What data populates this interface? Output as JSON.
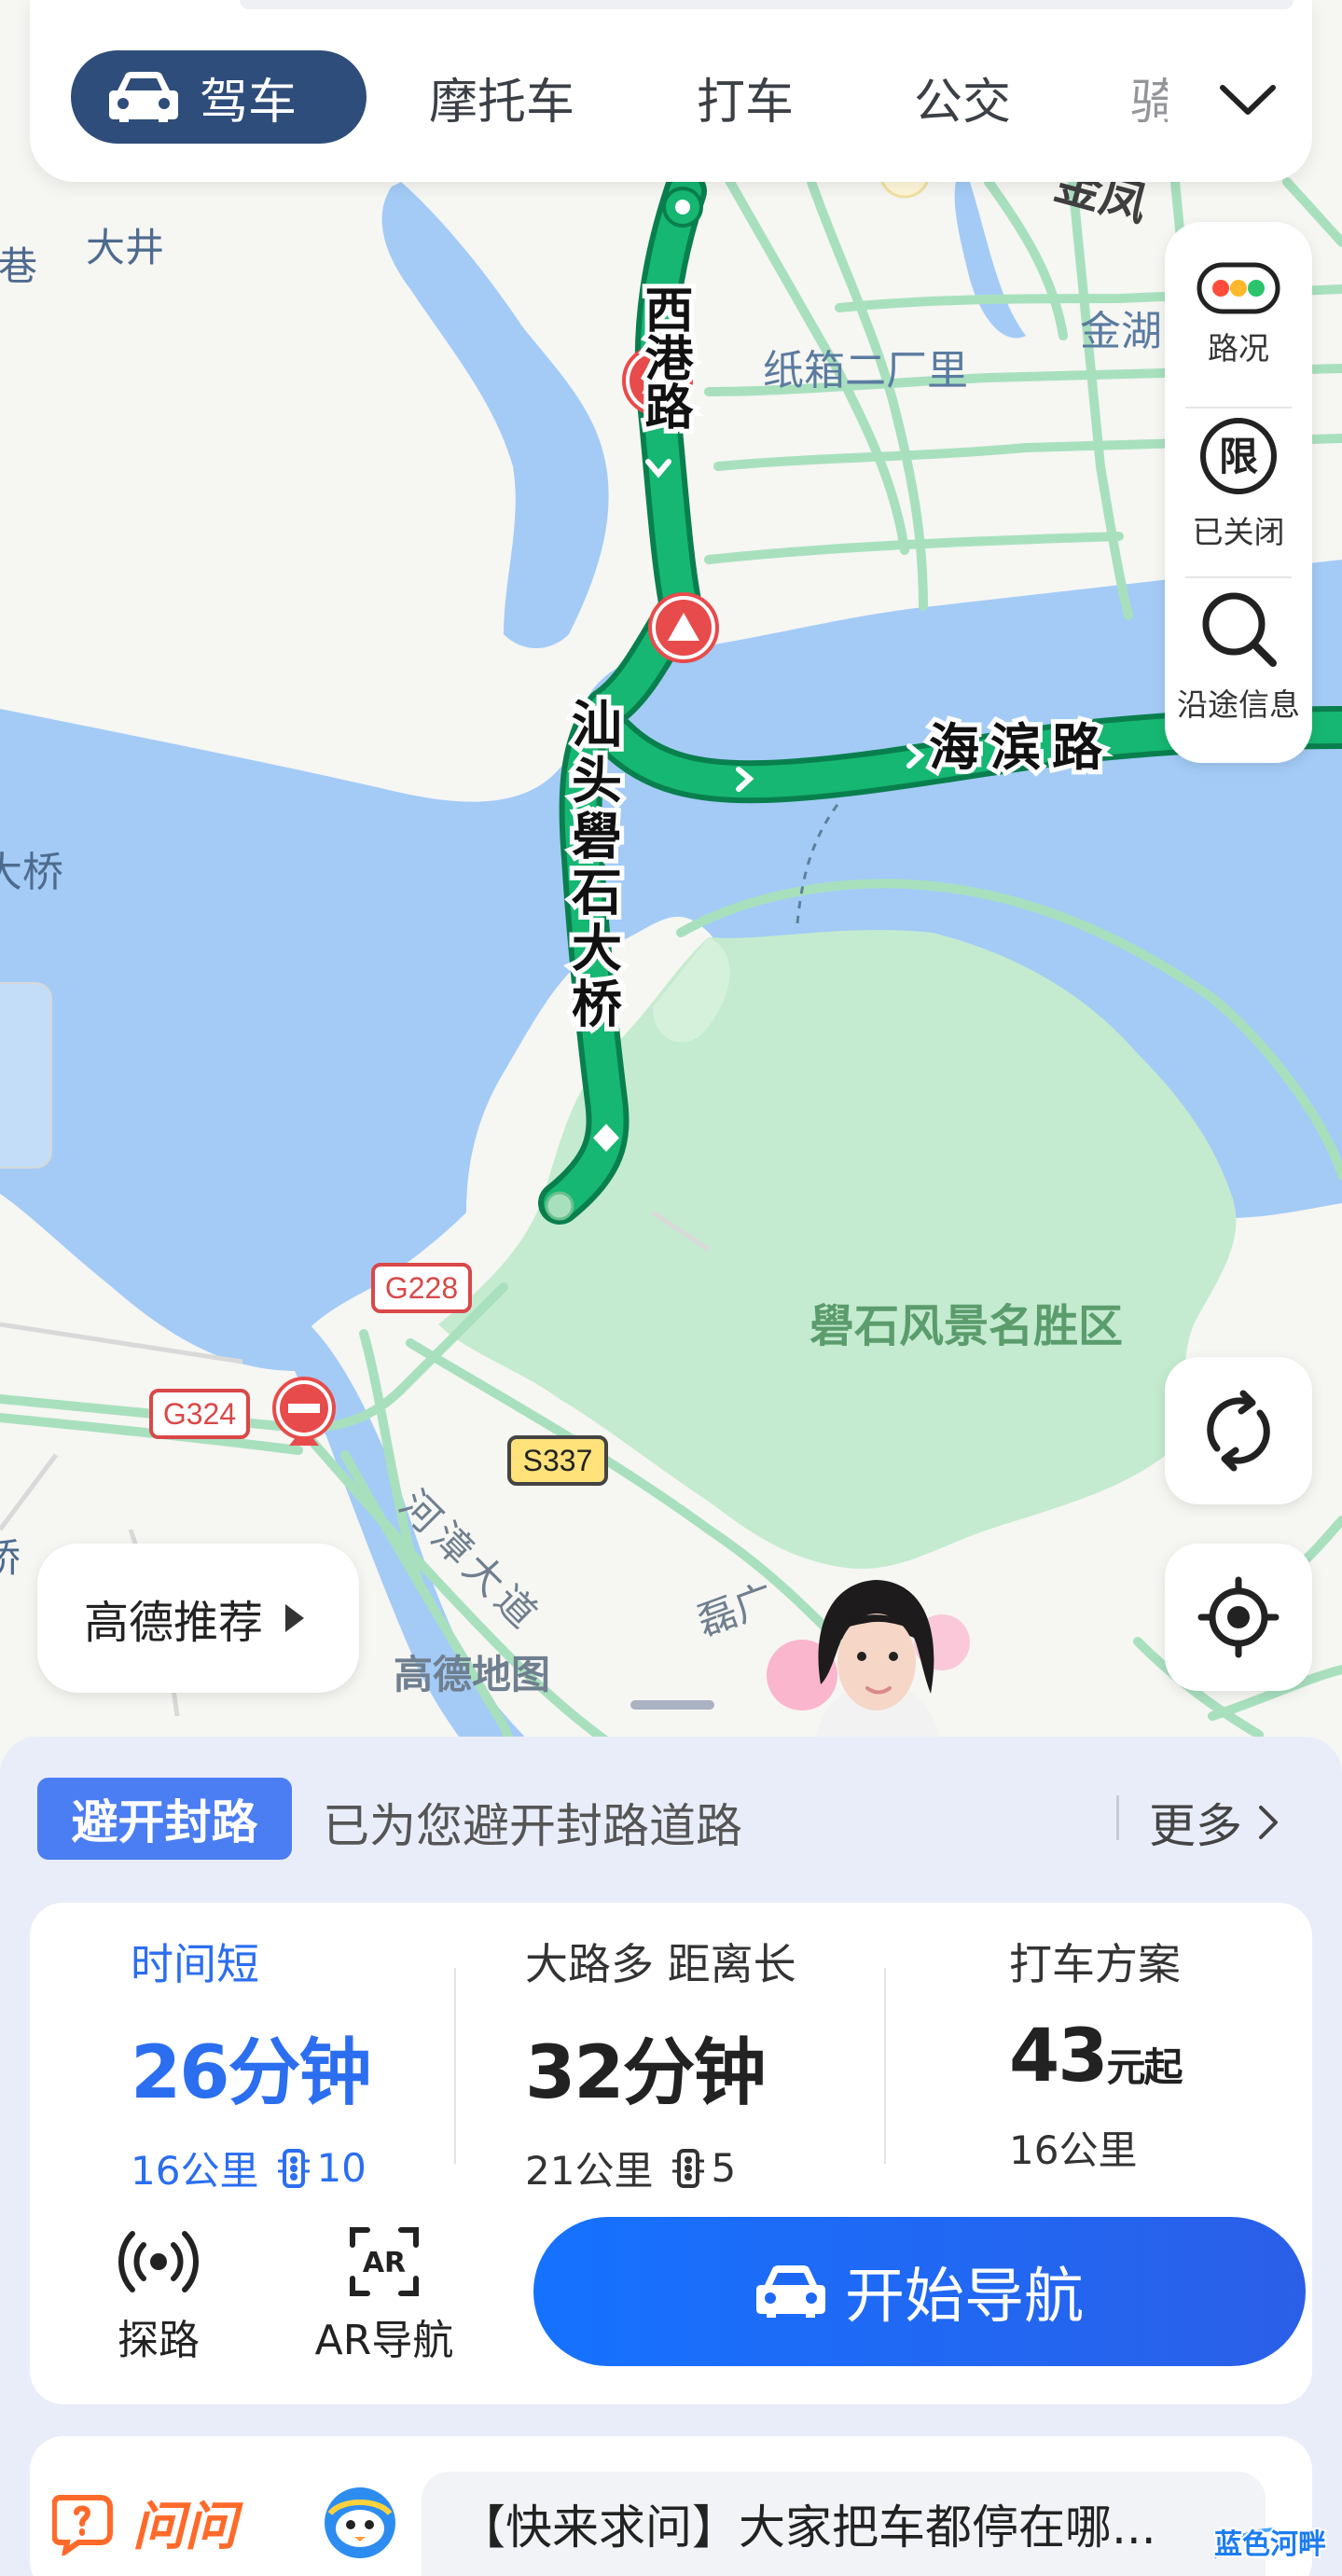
{
  "tabs": [
    {
      "label": "驾车"
    },
    {
      "label": "摩托车"
    },
    {
      "label": "打车"
    },
    {
      "label": "公交"
    },
    {
      "label": "骑"
    }
  ],
  "map": {
    "labels": {
      "dajing": "大井",
      "xigang": "西港路",
      "zhixiang": "纸箱二厂里",
      "jinhu": "金湖",
      "jinfeng": "金凤",
      "shantou_bridge": "汕头礐石大桥",
      "haibin": "海滨路",
      "daqiao_left": "大桥",
      "scenic": "礐石风景名胜区",
      "g228": "G228",
      "g324": "G324",
      "s337": "S337",
      "heyong": "河漳大道",
      "lei": "磊广",
      "gaode_map": "高德地图",
      "qiao_left": "桥",
      "xiang_left": "巷"
    }
  },
  "side_panel": {
    "traffic": "路况",
    "restriction": "已关闭",
    "restriction_icon_text": "限",
    "along_route": "沿途信息"
  },
  "recommend": "高德推荐",
  "avoid": {
    "badge": "避开封路",
    "text": "已为您避开封路道路",
    "more": "更多"
  },
  "routes": [
    {
      "tag": "时间短",
      "time_num": "26分钟",
      "distance": "16公里",
      "lights": "10"
    },
    {
      "tag": "大路多 距离长",
      "time_num": "32分钟",
      "distance": "21公里",
      "lights": "5"
    },
    {
      "tag": "打车方案",
      "time_num": "43",
      "time_unit": "元起",
      "distance": "16公里"
    }
  ],
  "tools": {
    "explore": "探路",
    "ar": "AR导航",
    "ar_icon_text": "AR"
  },
  "start_nav": "开始导航",
  "ask": {
    "logo": "问问",
    "text": "【快来求问】大家把车都停在哪..."
  },
  "watermark": "蓝色河畔",
  "colors": {
    "route_green": "#16b772",
    "water": "#a3cbf6",
    "park": "#c4ebcf",
    "primary_blue": "#2b6ef0",
    "topbar_active": "#2f4d7b"
  }
}
